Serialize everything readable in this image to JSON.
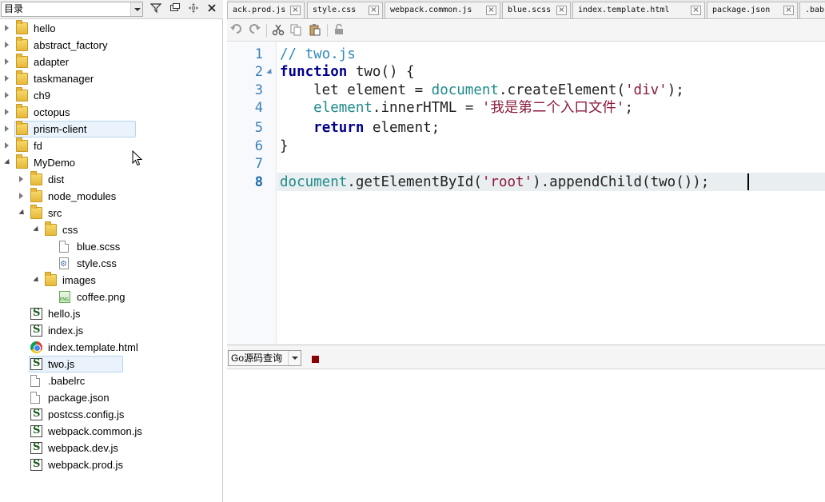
{
  "left_panel": {
    "combo_label": "目录",
    "icons": [
      "filter-icon",
      "window-icon",
      "move-icon",
      "close-icon"
    ],
    "tree": [
      {
        "label": "hello",
        "type": "folder",
        "expander": "collapsed"
      },
      {
        "label": "abstract_factory",
        "type": "folder",
        "expander": "collapsed"
      },
      {
        "label": "adapter",
        "type": "folder",
        "expander": "collapsed"
      },
      {
        "label": "taskmanager",
        "type": "folder",
        "expander": "collapsed"
      },
      {
        "label": "ch9",
        "type": "folder",
        "expander": "collapsed"
      },
      {
        "label": "octopus",
        "type": "folder",
        "expander": "collapsed"
      },
      {
        "label": "prism-client",
        "type": "folder",
        "expander": "collapsed",
        "highlighted": true
      },
      {
        "label": "fd",
        "type": "folder",
        "expander": "collapsed"
      },
      {
        "label": "MyDemo",
        "type": "folder",
        "expander": "expanded"
      },
      {
        "label": "dist",
        "type": "folder",
        "expander": "collapsed"
      },
      {
        "label": "node_modules",
        "type": "folder",
        "expander": "collapsed"
      },
      {
        "label": "src",
        "type": "folder",
        "expander": "expanded"
      },
      {
        "label": "css",
        "type": "folder",
        "expander": "expanded"
      },
      {
        "label": "blue.scss",
        "type": "file"
      },
      {
        "label": "style.css",
        "type": "css-file"
      },
      {
        "label": "images",
        "type": "folder",
        "expander": "expanded"
      },
      {
        "label": "coffee.png",
        "type": "png-file"
      },
      {
        "label": "hello.js",
        "type": "js-file"
      },
      {
        "label": "index.js",
        "type": "js-file"
      },
      {
        "label": "index.template.html",
        "type": "html-file"
      },
      {
        "label": "two.js",
        "type": "js-file",
        "highlighted": true
      },
      {
        "label": ".babelrc",
        "type": "file"
      },
      {
        "label": "package.json",
        "type": "file"
      },
      {
        "label": "postcss.config.js",
        "type": "js-file"
      },
      {
        "label": "webpack.common.js",
        "type": "js-file"
      },
      {
        "label": "webpack.dev.js",
        "type": "js-file"
      },
      {
        "label": "webpack.prod.js",
        "type": "js-file"
      }
    ]
  },
  "tabs": [
    {
      "label": "ack.prod.js"
    },
    {
      "label": "style.css"
    },
    {
      "label": "webpack.common.js"
    },
    {
      "label": "blue.scss"
    },
    {
      "label": "index.template.html"
    },
    {
      "label": "package.json"
    },
    {
      "label": ".bab"
    }
  ],
  "toolbar": {
    "icons": [
      "undo-icon",
      "redo-icon",
      "cut-icon",
      "copy-icon",
      "paste-icon",
      "lock-icon"
    ]
  },
  "editor": {
    "current_line": 8,
    "lines": [
      {
        "number": "1",
        "tokens": [
          {
            "t": "// two.js",
            "c": "comment"
          }
        ]
      },
      {
        "number": "2",
        "tokens": [
          {
            "t": "function",
            "c": "kw"
          },
          {
            "t": " two() {",
            "c": "plain"
          }
        ]
      },
      {
        "number": "3",
        "tokens": [
          {
            "t": "    let element = ",
            "c": "plain"
          },
          {
            "t": "document",
            "c": "obj"
          },
          {
            "t": ".createElement(",
            "c": "plain"
          },
          {
            "t": "'div'",
            "c": "str"
          },
          {
            "t": ");",
            "c": "plain"
          }
        ]
      },
      {
        "number": "4",
        "tokens": [
          {
            "t": "    ",
            "c": "plain"
          },
          {
            "t": "element",
            "c": "obj"
          },
          {
            "t": ".innerHTML = ",
            "c": "plain"
          },
          {
            "t": "'我是第二个入口文件'",
            "c": "str"
          },
          {
            "t": ";",
            "c": "plain"
          }
        ]
      },
      {
        "number": "5",
        "tokens": [
          {
            "t": "    ",
            "c": "plain"
          },
          {
            "t": "return",
            "c": "kw"
          },
          {
            "t": " element;",
            "c": "plain"
          }
        ]
      },
      {
        "number": "6",
        "tokens": [
          {
            "t": "}",
            "c": "plain"
          }
        ]
      },
      {
        "number": "7",
        "tokens": []
      },
      {
        "number": "8",
        "tokens": [
          {
            "t": "document",
            "c": "obj"
          },
          {
            "t": ".getElementById(",
            "c": "plain"
          },
          {
            "t": "'root'",
            "c": "str"
          },
          {
            "t": ").appendChild(two());",
            "c": "plain"
          }
        ]
      }
    ]
  },
  "bottom_panel": {
    "query_select_value": "Go源码查询",
    "stop_icon": "stop-icon"
  },
  "colors": {
    "comment": "#2e8bb6",
    "keyword": "#00008b",
    "string": "#8b1a3b",
    "object": "#1f8a8a",
    "line_number": "#3b7fb8",
    "stop": "#8b0000"
  }
}
